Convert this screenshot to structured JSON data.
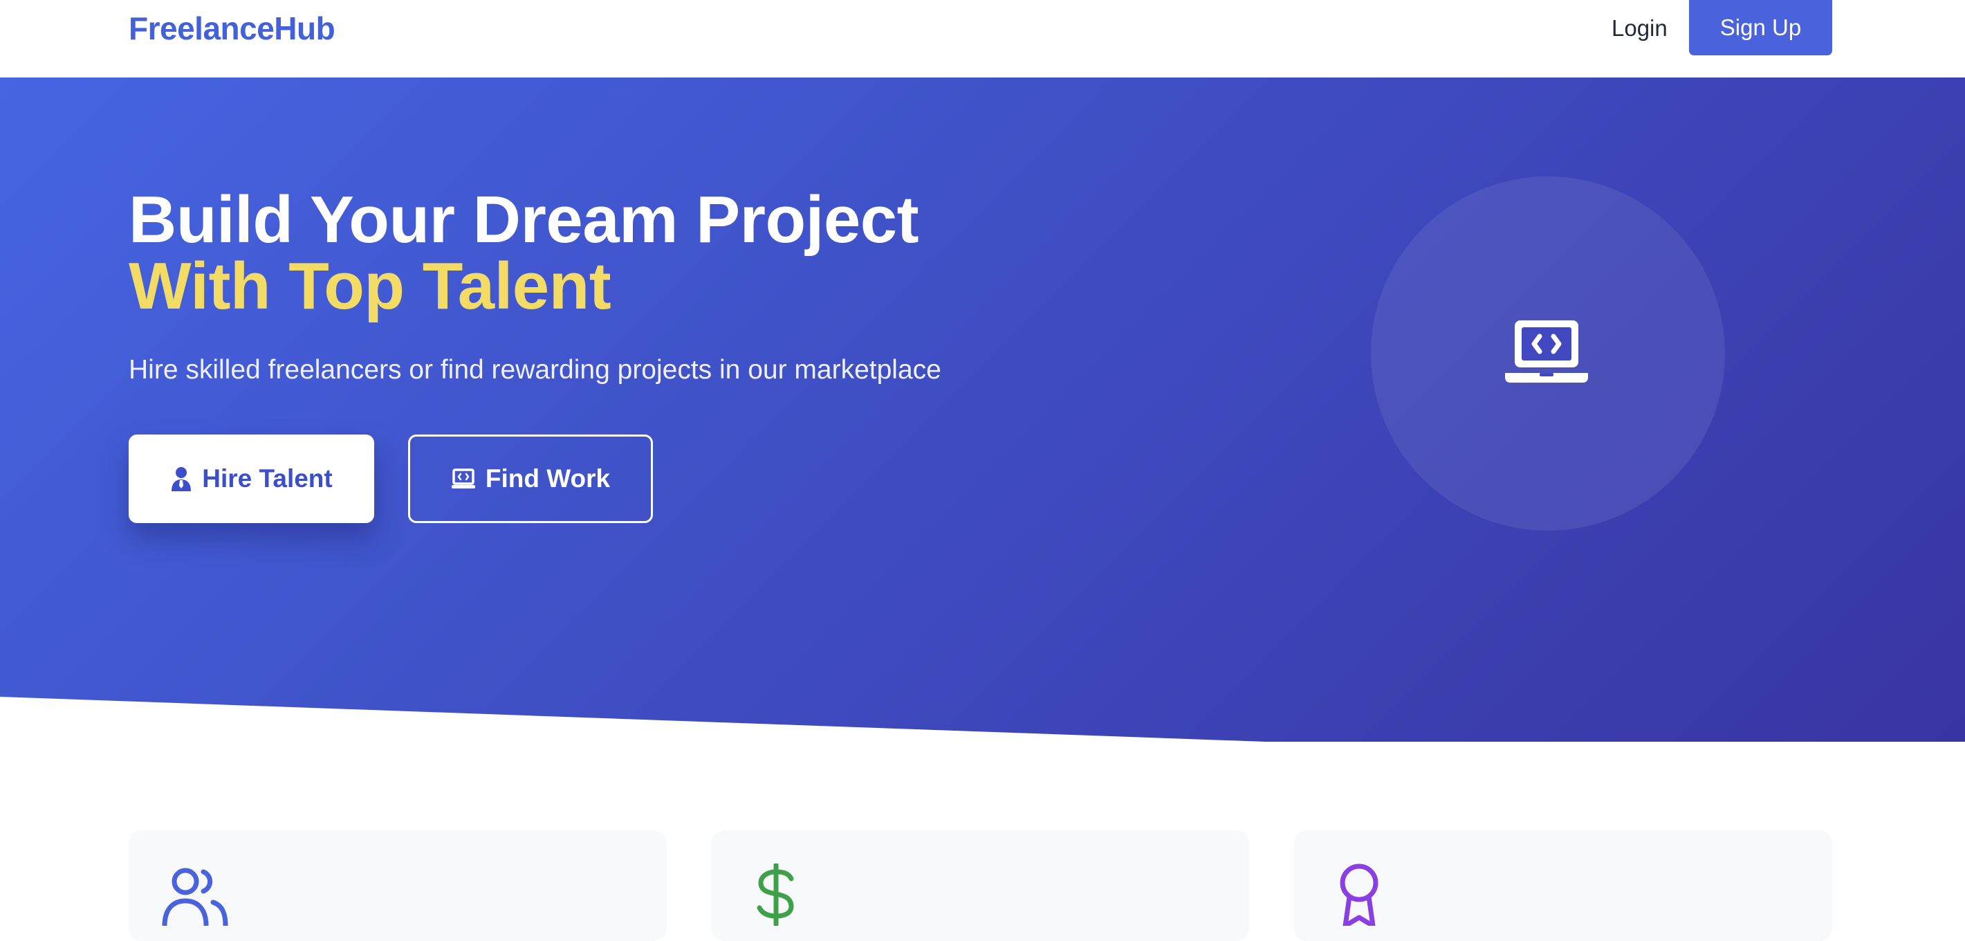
{
  "nav": {
    "logo": "FreelanceHub",
    "login_label": "Login",
    "signup_label": "Sign Up"
  },
  "hero": {
    "title_line1": "Build Your Dream Project",
    "title_line2": "With Top Talent",
    "subtitle": "Hire skilled freelancers or find rewarding projects in our marketplace",
    "hire_button": {
      "label": "Hire Talent",
      "icon": "user-tie-icon"
    },
    "find_button": {
      "label": "Find Work",
      "icon": "laptop-code-icon"
    },
    "illustration_icon": "laptop-code-icon"
  },
  "features": [
    {
      "icon": "users-icon",
      "color": "#4a62dc"
    },
    {
      "icon": "dollar-icon",
      "color": "#3fa04a"
    },
    {
      "icon": "award-icon",
      "color": "#8a3fe0"
    }
  ],
  "colors": {
    "brand": "#4361d8",
    "hero_gradient_start": "#4665e2",
    "hero_gradient_end": "#3934a3",
    "accent_yellow": "#f3dc66"
  }
}
